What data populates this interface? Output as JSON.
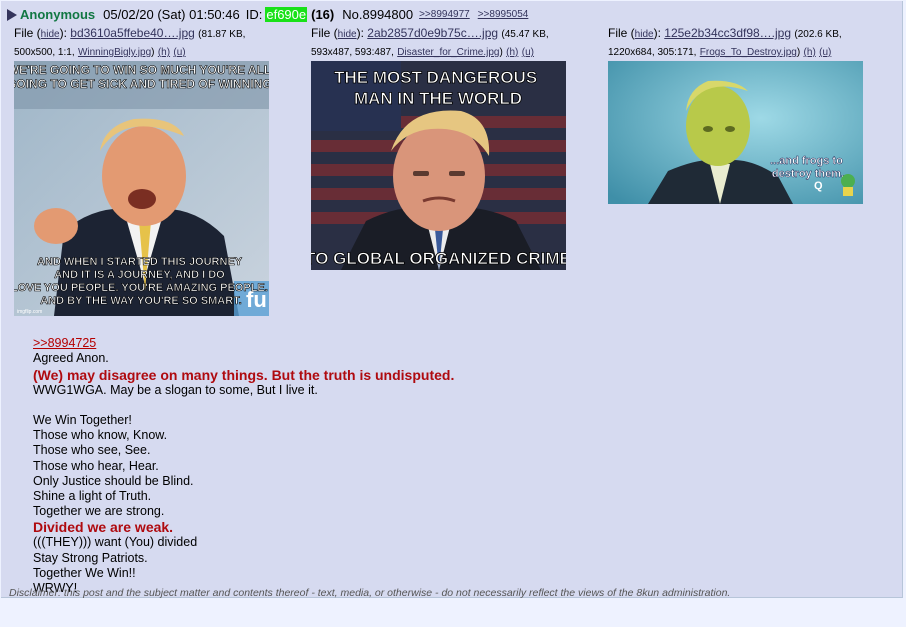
{
  "header": {
    "name": "Anonymous",
    "date": "05/02/20 (Sat) 01:50:46",
    "id_label": "ID:",
    "id": "ef690e",
    "count": "(16)",
    "post_no": "No.8994800",
    "backlinks": [
      ">>8994977",
      ">>8995054"
    ]
  },
  "files": [
    {
      "file_label": "File (",
      "hide": "hide",
      "sep": "):",
      "name": "bd3610a5ffebe40….jpg",
      "size": "(81.87 KB,",
      "dims": "500x500, 1:1,",
      "orig": "WinningBigly.jpg",
      "h": "(h)",
      "u": "(u)",
      "image": {
        "top_text": "WE'RE GOING TO WIN SO MUCH YOU'RE ALL GOING TO GET SICK AND TIRED OF WINNING.",
        "bottom_text": "AND WHEN I STARTED THIS JOURNEY AND IT IS A JOURNEY, AND I DO LOVE YOU PEOPLE. YOU'RE AMAZING PEOPLE. AND BY THE WAY YOU'RE SO SMART.",
        "watermark": "imgflip.com"
      }
    },
    {
      "file_label": "File (",
      "hide": "hide",
      "sep": "):",
      "name": "2ab2857d0e9b75c….jpg",
      "size": "(45.47 KB,",
      "dims": "593x487, 593:487,",
      "orig": "Disaster_for_Crime.jpg",
      "h": "(h)",
      "u": "(u)",
      "image": {
        "top_text": "THE MOST DANGEROUS MAN IN THE WORLD",
        "bottom_text": "TO GLOBAL ORGANIZED CRIME"
      }
    },
    {
      "file_label": "File (",
      "hide": "hide",
      "sep": "):",
      "name": "125e2b34cc3df98….jpg",
      "size": "(202.6 KB,",
      "dims": "1220x684, 305:171,",
      "orig": "Frogs_To_Destroy.jpg",
      "h": "(h)",
      "u": "(u)",
      "image": {
        "caption": "...and frogs to destroy them.",
        "sig": "Q"
      }
    }
  ],
  "body": {
    "quote": ">>8994725",
    "lines1": [
      "Agreed Anon."
    ],
    "heading1": "(We) may disagree on many things. But the truth is undisputed.",
    "lines2": [
      "WWG1WGA. May be a slogan to some, But I live it.",
      "",
      "We Win Together!",
      "Those who know, Know.",
      "Those who see, See.",
      "Those who hear, Hear.",
      "Only Justice should be Blind.",
      "Shine a light of Truth.",
      "Together we are strong."
    ],
    "heading2": "Divided we are weak.",
    "lines3": [
      "(((THEY))) want (You) divided",
      "Stay Strong Patriots.",
      "Together We Win!!",
      "WRWY!"
    ]
  },
  "disclaimer": "Disclaimer: this post and the subject matter and contents thereof - text, media, or otherwise - do not necessarily reflect the views of the 8kun administration.",
  "colors": {
    "name": "#117743",
    "id_bg": "#19e119",
    "heading": "#af0a0f",
    "link": "#34345c",
    "post_bg": "#d6daf0"
  }
}
